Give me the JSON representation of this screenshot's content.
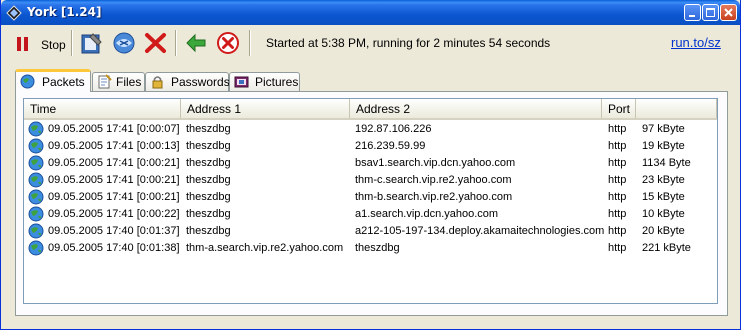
{
  "window": {
    "title": "York [1.24]"
  },
  "toolbar": {
    "stop_label": "Stop",
    "status": "Started at 5:38 PM, running for 2 minutes 54 seconds",
    "link": "run.to/sz"
  },
  "tabs": [
    {
      "label": "Packets",
      "active": true
    },
    {
      "label": "Files",
      "active": false
    },
    {
      "label": "Passwords",
      "active": false
    },
    {
      "label": "Pictures",
      "active": false
    }
  ],
  "columns": [
    "Time",
    "Address 1",
    "Address 2",
    "Port",
    ""
  ],
  "rows": [
    {
      "time": "09.05.2005 17:41 [0:00:07]",
      "addr1": "theszdbg",
      "addr2": "192.87.106.226",
      "port": "http",
      "size": "97 kByte"
    },
    {
      "time": "09.05.2005 17:41 [0:00:13]",
      "addr1": "theszdbg",
      "addr2": "216.239.59.99",
      "port": "http",
      "size": "19 kByte"
    },
    {
      "time": "09.05.2005 17:41 [0:00:21]",
      "addr1": "theszdbg",
      "addr2": "bsav1.search.vip.dcn.yahoo.com",
      "port": "http",
      "size": "1134 Byte"
    },
    {
      "time": "09.05.2005 17:41 [0:00:21]",
      "addr1": "theszdbg",
      "addr2": "thm-c.search.vip.re2.yahoo.com",
      "port": "http",
      "size": "23 kByte"
    },
    {
      "time": "09.05.2005 17:41 [0:00:21]",
      "addr1": "theszdbg",
      "addr2": "thm-b.search.vip.re2.yahoo.com",
      "port": "http",
      "size": "15 kByte"
    },
    {
      "time": "09.05.2005 17:41 [0:00:22]",
      "addr1": "theszdbg",
      "addr2": "a1.search.vip.dcn.yahoo.com",
      "port": "http",
      "size": "10 kByte"
    },
    {
      "time": "09.05.2005 17:40 [0:01:37]",
      "addr1": "theszdbg",
      "addr2": "a212-105-197-134.deploy.akamaitechnologies.com",
      "port": "http",
      "size": "20 kByte"
    },
    {
      "time": "09.05.2005 17:40 [0:01:38]",
      "addr1": "thm-a.search.vip.re2.yahoo.com",
      "addr2": "theszdbg",
      "port": "http",
      "size": "221 kByte"
    }
  ]
}
